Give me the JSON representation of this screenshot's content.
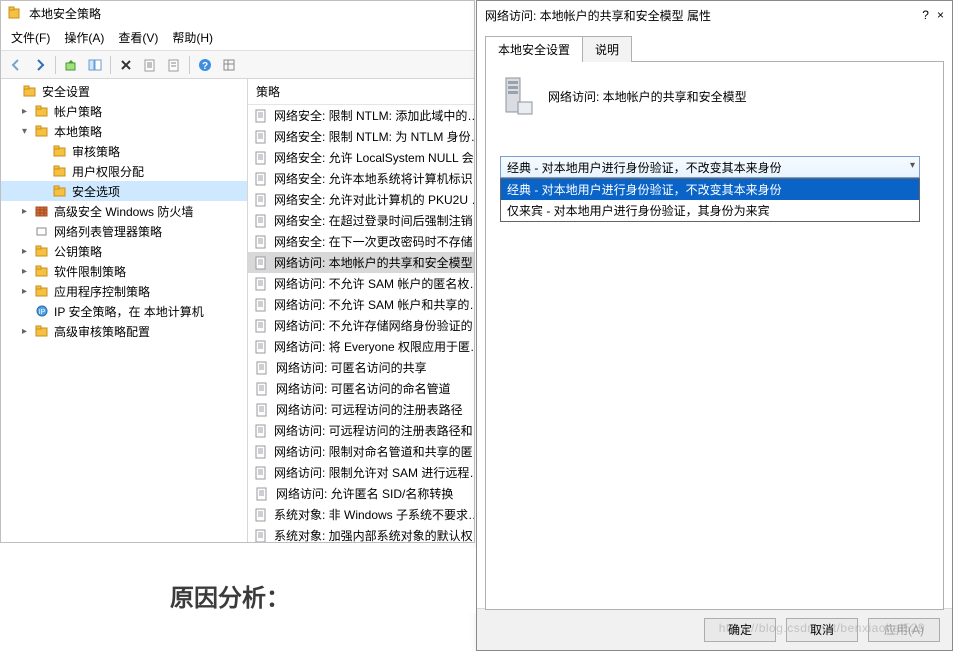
{
  "mmc": {
    "title": "本地安全策略",
    "menus": [
      "文件(F)",
      "操作(A)",
      "查看(V)",
      "帮助(H)"
    ],
    "tree_header": "安全设置",
    "tree": {
      "root": "安全设置",
      "account": "帐户策略",
      "local": "本地策略",
      "audit": "审核策略",
      "rights": "用户权限分配",
      "options": "安全选项",
      "firewall": "高级安全 Windows 防火墙",
      "netlist": "网络列表管理器策略",
      "pubkey": "公钥策略",
      "swrestrict": "软件限制策略",
      "appctrl": "应用程序控制策略",
      "ipsec": "IP 安全策略，在 本地计算机",
      "advaudit": "高级审核策略配置"
    },
    "list_header": "策略",
    "policies": [
      "网络安全: 限制 NTLM: 添加此域中的…",
      "网络安全: 限制 NTLM: 为 NTLM 身份…",
      "网络安全: 允许 LocalSystem NULL 会…",
      "网络安全: 允许本地系统将计算机标识…",
      "网络安全: 允许对此计算机的 PKU2U …",
      "网络安全: 在超过登录时间后强制注销…",
      "网络安全: 在下一次更改密码时不存储…",
      "网络访问: 本地帐户的共享和安全模型",
      "网络访问: 不允许 SAM 帐户的匿名枚…",
      "网络访问: 不允许 SAM 帐户和共享的…",
      "网络访问: 不允许存储网络身份验证的…",
      "网络访问: 将 Everyone 权限应用于匿…",
      "网络访问: 可匿名访问的共享",
      "网络访问: 可匿名访问的命名管道",
      "网络访问: 可远程访问的注册表路径",
      "网络访问: 可远程访问的注册表路径和…",
      "网络访问: 限制对命名管道和共享的匿…",
      "网络访问: 限制允许对 SAM 进行远程…",
      "网络访问: 允许匿名 SID/名称转换",
      "系统对象: 非 Windows 子系统不要求…",
      "系统对象: 加强内部系统对象的默认权…"
    ],
    "selected_index": 7
  },
  "dialog": {
    "title": "网络访问: 本地帐户的共享和安全模型 属性",
    "help": "?",
    "close": "×",
    "tab_settings": "本地安全设置",
    "tab_explain": "说明",
    "summary": "网络访问: 本地帐户的共享和安全模型",
    "selected_option": "经典 - 对本地用户进行身份验证，不改变其本来身份",
    "options": [
      "经典 - 对本地用户进行身份验证，不改变其本来身份",
      "仅来宾 - 对本地用户进行身份验证，其身份为来宾"
    ],
    "ok": "确定",
    "cancel": "取消",
    "apply": "应用(A)"
  },
  "article": {
    "heading": "原因分析："
  },
  "watermark": "https://blog.csdn.net/benxiaohai529"
}
